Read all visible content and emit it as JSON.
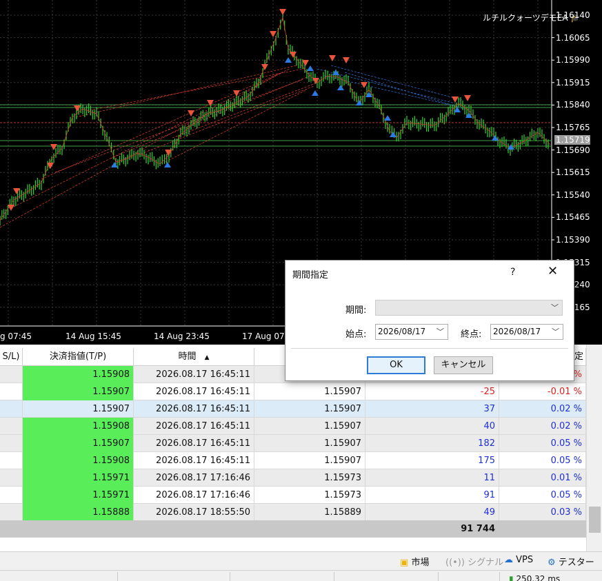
{
  "chart": {
    "ea_label": "ルチルクォーツデモEA",
    "price_axis": [
      "1.16140",
      "1.16065",
      "1.15990",
      "1.15915",
      "1.15840",
      "1.15765",
      "1.15690",
      "1.15615",
      "1.15540",
      "1.15465",
      "1.15390",
      "1.15315",
      "1.15240",
      "1.15165"
    ],
    "current_price": "1.15719",
    "time_axis": [
      "g 07:45",
      "14 Aug 15:45",
      "14 Aug 23:45",
      "17 Aug 07:"
    ],
    "colors": {
      "background": "#000000",
      "grid": "#3a3a3a",
      "candles": "#2fd32f",
      "sell_arrow": "#e8553a",
      "buy_arrow": "#2c7be5",
      "level_green": "#43a047",
      "level_red": "#c0392b"
    }
  },
  "table": {
    "headers": [
      "S/L)",
      "決済指値(T/P)",
      "時間",
      "",
      "",
      "定"
    ],
    "rows": [
      {
        "tp": "1.15908",
        "time": "2026.08.17 16:45:11",
        "price": "",
        "profit": "",
        "pct": "%",
        "style": "alt",
        "tp_green": true,
        "sign": "red"
      },
      {
        "tp": "1.15907",
        "time": "2026.08.17 16:45:11",
        "price": "1.15907",
        "profit": "-25",
        "pct": "-0.01 %",
        "style": "plain",
        "tp_green": true,
        "sign": "red"
      },
      {
        "tp": "1.15907",
        "time": "2026.08.17 16:45:11",
        "price": "1.15907",
        "profit": "37",
        "pct": "0.02 %",
        "style": "sel",
        "tp_green": false,
        "sign": "blue"
      },
      {
        "tp": "1.15908",
        "time": "2026.08.17 16:45:11",
        "price": "1.15907",
        "profit": "40",
        "pct": "0.02 %",
        "style": "alt",
        "tp_green": true,
        "sign": "blue"
      },
      {
        "tp": "1.15907",
        "time": "2026.08.17 16:45:11",
        "price": "1.15907",
        "profit": "182",
        "pct": "0.05 %",
        "style": "alt",
        "tp_green": true,
        "sign": "blue"
      },
      {
        "tp": "1.15908",
        "time": "2026.08.17 16:45:11",
        "price": "1.15907",
        "profit": "175",
        "pct": "0.05 %",
        "style": "plain",
        "tp_green": true,
        "sign": "blue"
      },
      {
        "tp": "1.15971",
        "time": "2026.08.17 17:16:46",
        "price": "1.15973",
        "profit": "11",
        "pct": "0.01 %",
        "style": "alt",
        "tp_green": true,
        "sign": "blue"
      },
      {
        "tp": "1.15971",
        "time": "2026.08.17 17:16:46",
        "price": "1.15973",
        "profit": "91",
        "pct": "0.05 %",
        "style": "plain",
        "tp_green": true,
        "sign": "blue"
      },
      {
        "tp": "1.15888",
        "time": "2026.08.17 18:55:50",
        "price": "1.15889",
        "profit": "49",
        "pct": "0.03 %",
        "style": "alt",
        "tp_green": true,
        "sign": "blue"
      }
    ],
    "total": "91 744",
    "sort_indicator": "▲"
  },
  "status": {
    "market": "市場",
    "signal": "シグナル",
    "vps": "VPS",
    "tester": "テスター",
    "ping": "250.32 ms"
  },
  "dialog": {
    "title": "期間指定",
    "help": "?",
    "close": "✕",
    "period_label": "期間:",
    "period_value": "",
    "start_label": "始点:",
    "start_value": "2026/08/17",
    "end_label": "終点:",
    "end_value": "2026/08/17",
    "ok_label": "OK",
    "cancel_label": "キャンセル"
  }
}
